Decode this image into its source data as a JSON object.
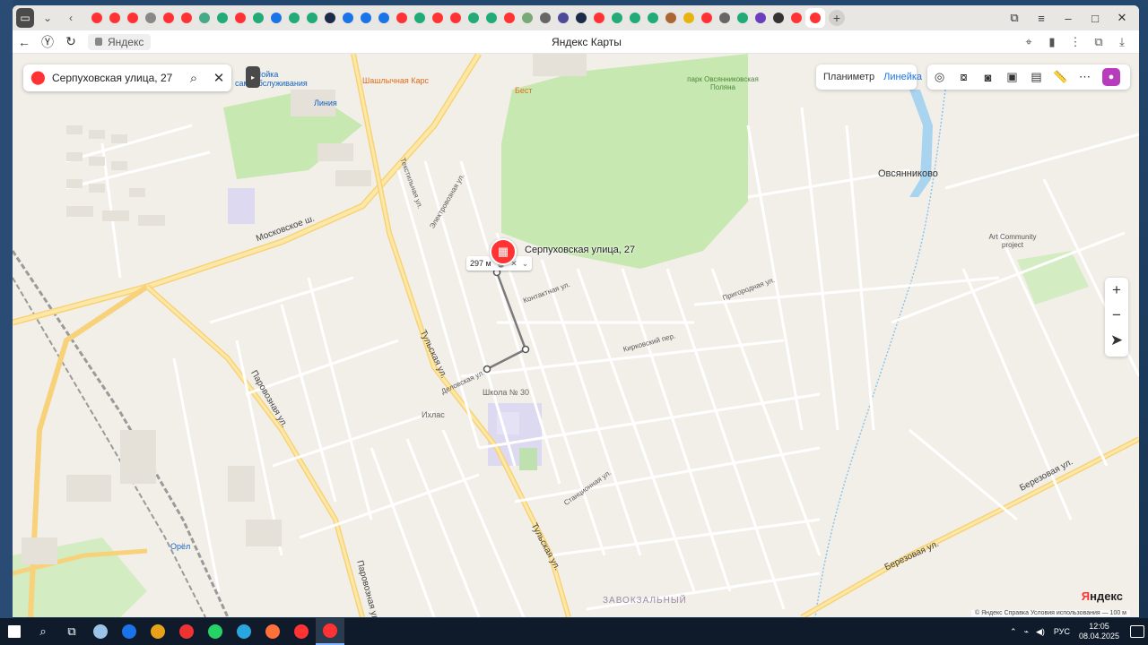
{
  "browser": {
    "window_controls": [
      "⧉",
      "≡",
      "–",
      "□",
      "✕"
    ],
    "tabs_favicon_colors": [
      "#f33",
      "#f33",
      "#f33",
      "#888",
      "#f33",
      "#f33",
      "#4a8",
      "#2a7",
      "#f33",
      "#2a7",
      "#1a73e8",
      "#2a7",
      "#2a7",
      "#1b2b4a",
      "#1a73e8",
      "#1a73e8",
      "#1a73e8",
      "#f33",
      "#2a7",
      "#f33",
      "#f33",
      "#2a7",
      "#2a7",
      "#f33",
      "#7a7",
      "#666",
      "#4b4b9a",
      "#1b2b4a",
      "#f33",
      "#2a7",
      "#2a7",
      "#2a7",
      "#a63",
      "#e9b30f",
      "#f33",
      "#666",
      "#2a7",
      "#6a3dbd",
      "#333",
      "#f33",
      "#f33"
    ],
    "new_tab_label": "+",
    "address": {
      "url_label": "Яндекс",
      "page_title": "Яндекс Карты"
    }
  },
  "map": {
    "search": {
      "query": "Серпуховская улица, 27",
      "search_icon": "search-icon",
      "close_icon": "close-icon"
    },
    "tools": {
      "planimeter_label": "Планиметр",
      "ruler_label": "Линейка"
    },
    "zoom": {
      "in_label": "+",
      "out_label": "−",
      "locate_label": "➤"
    },
    "measurement": {
      "distance": "297 м"
    },
    "place": {
      "name": "Серпуховская улица, 27"
    },
    "labels": {
      "moscow_sh": "Московское ш.",
      "tulskaya": "Тульская ул.",
      "tulskaya2": "Тульская ул.",
      "paravoznaya": "Паровозная ул.",
      "paravoznaya2": "Паровозная ул.",
      "berezovaya": "Березовая ул.",
      "berezovaya2": "Березовая ул.",
      "ovsyannikovo": "Овсянниково",
      "district": "ЗАВОКЗАЛЬНЫЙ",
      "park": "парк Овсянниковская Поляна",
      "school": "Школа № 30",
      "ikhlas": "Ихлас",
      "moika": "Мойка самообслуживания",
      "liniya": "Линия",
      "shashlyk": "Шашлычная Карс",
      "best": "Бест",
      "art": "Art Community project",
      "orel": "Орёл",
      "kontaktnaya": "Контактная ул.",
      "delovskaya": "Деловская ул.",
      "karkovskiy": "Кирковский пер.",
      "stancionnaya": "Станционная ул.",
      "priokrugnaya": "Пригородная ул.",
      "tekstilnaya": "Текстильная ул.",
      "elektrovoznaya": "Электровозная ул."
    },
    "brand": {
      "part1": "Я",
      "part2": "ндекс"
    },
    "footer": "© Яндекс   Справка   Условия использования   ⁠— 100 м"
  },
  "taskbar": {
    "app_colors": [
      "#9cc3e6",
      "#1a73e8",
      "#e8a21a",
      "#e33",
      "#25d366",
      "#2aa6df",
      "#ff7139",
      "#f33",
      "#f33"
    ],
    "lang": "РУС",
    "time": "12:05",
    "date": "08.04.2025"
  }
}
